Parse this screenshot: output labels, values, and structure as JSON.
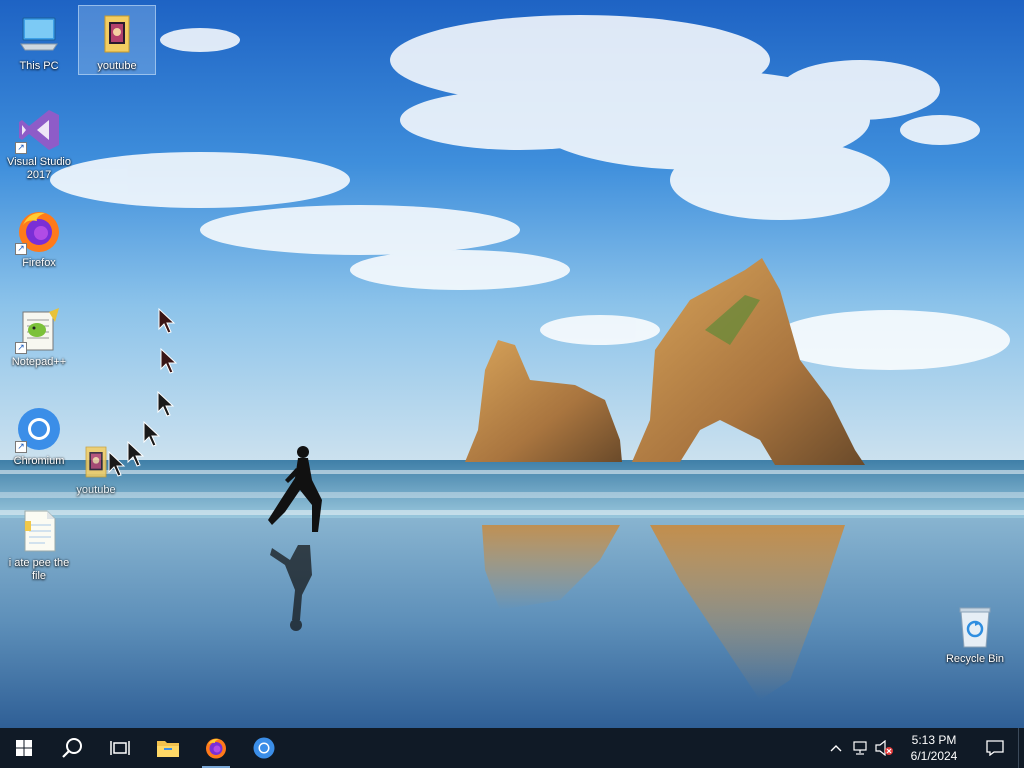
{
  "desktop": {
    "icons": [
      {
        "label": "This PC",
        "icon": "this-pc-icon"
      },
      {
        "label": "youtube",
        "icon": "folder-icon",
        "selected": true
      },
      {
        "label": "Visual Studio 2017",
        "icon": "visual-studio-icon",
        "shortcut": true
      },
      {
        "label": "Firefox",
        "icon": "firefox-icon",
        "shortcut": true
      },
      {
        "label": "Notepad++",
        "icon": "notepad-plus-plus-icon",
        "shortcut": true
      },
      {
        "label": "Chromium",
        "icon": "chromium-icon",
        "shortcut": true
      },
      {
        "label": "youtube",
        "icon": "folder-icon",
        "dragging": true
      },
      {
        "label": "i ate pee the file",
        "icon": "text-file-icon"
      },
      {
        "label": "Recycle Bin",
        "icon": "recycle-bin-icon"
      }
    ],
    "wallpaper": "beach with rock arches and runner",
    "cursor_count": 6
  },
  "taskbar": {
    "start_icon": "windows-start-icon",
    "search_icon": "search-icon",
    "task_view_icon": "task-view-icon",
    "pinned": [
      {
        "name": "File Explorer",
        "icon": "file-explorer-icon"
      },
      {
        "name": "Firefox",
        "icon": "firefox-icon",
        "active": true
      },
      {
        "name": "Chromium",
        "icon": "chromium-icon"
      }
    ],
    "tray": {
      "chevron_icon": "chevron-up-icon",
      "network_icon": "network-icon",
      "volume_icon": "volume-muted-icon",
      "time": "5:13 PM",
      "date": "6/1/2024",
      "notification_icon": "notification-icon"
    },
    "colors": {
      "background": "#101a26",
      "active_indicator": "#7aa7d6"
    }
  }
}
